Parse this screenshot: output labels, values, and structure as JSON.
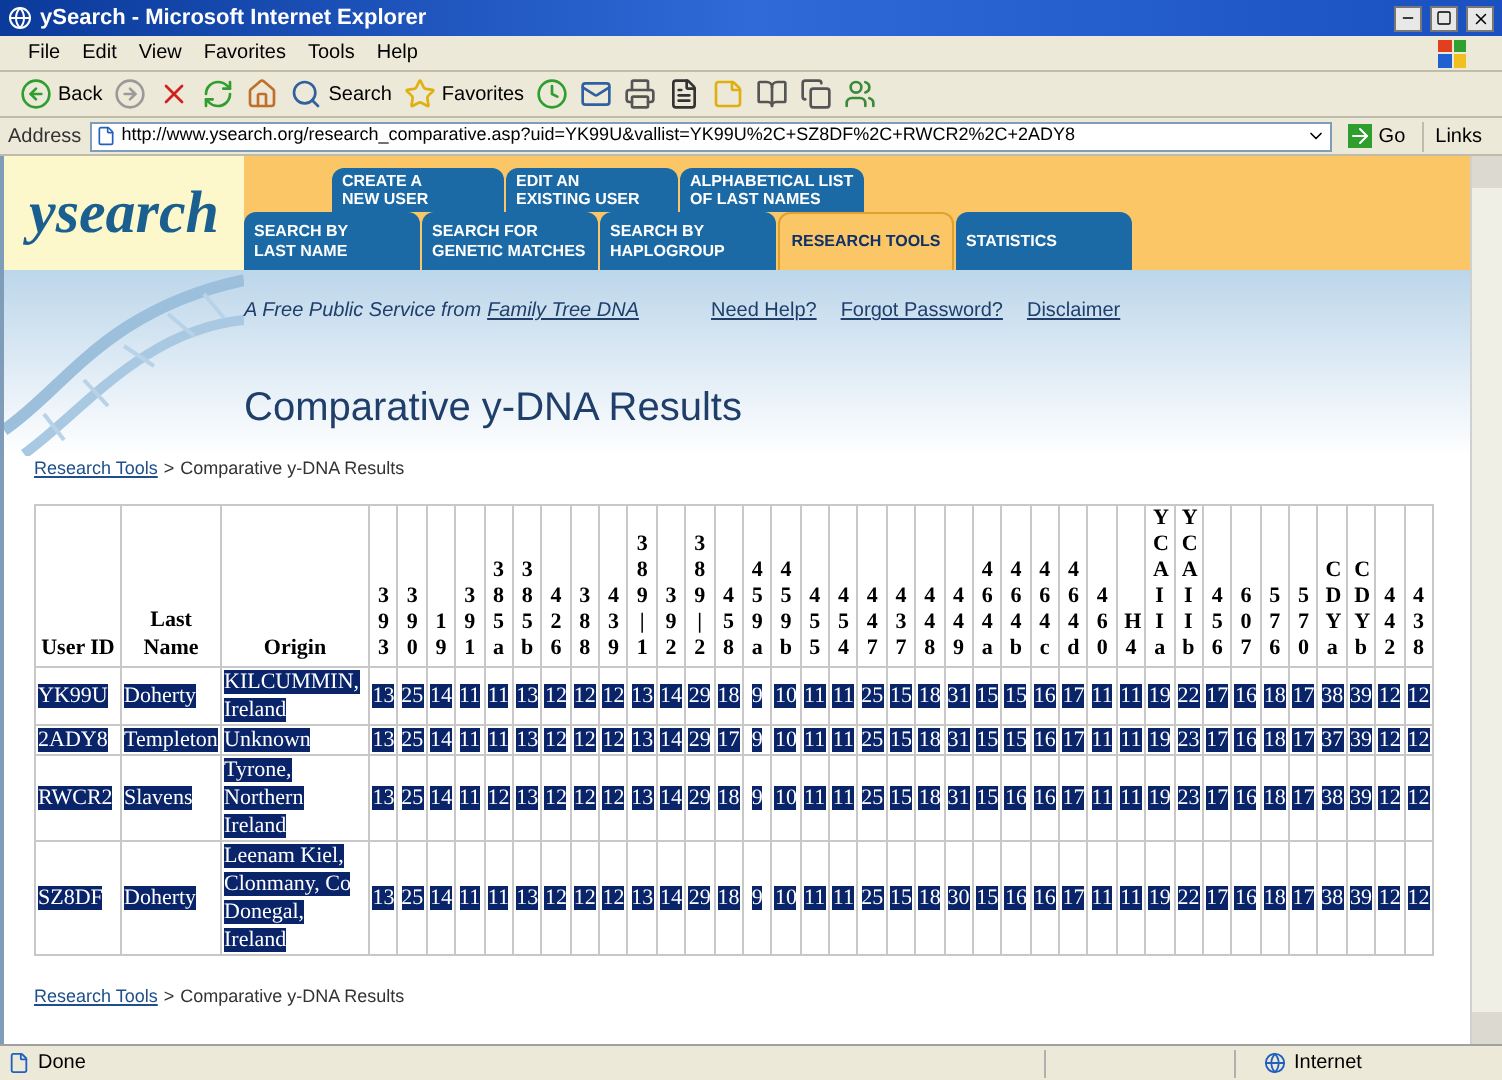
{
  "window": {
    "title": "ySearch - Microsoft Internet Explorer"
  },
  "menu": [
    "File",
    "Edit",
    "View",
    "Favorites",
    "Tools",
    "Help"
  ],
  "toolbar": [
    {
      "kind": "back",
      "label": "Back"
    },
    {
      "kind": "forward"
    },
    {
      "kind": "stop"
    },
    {
      "kind": "refresh"
    },
    {
      "kind": "home"
    },
    {
      "kind": "search",
      "label": "Search"
    },
    {
      "kind": "favorites",
      "label": "Favorites"
    },
    {
      "kind": "history"
    },
    {
      "kind": "mail"
    },
    {
      "kind": "print"
    },
    {
      "kind": "edit"
    },
    {
      "kind": "note"
    },
    {
      "kind": "research"
    },
    {
      "kind": "copy"
    },
    {
      "kind": "messenger"
    }
  ],
  "address": {
    "label": "Address",
    "value": "http://www.ysearch.org/research_comparative.asp?uid=YK99U&vallist=YK99U%2C+SZ8DF%2C+RWCR2%2C+2ADY8",
    "go": "Go",
    "links": "Links"
  },
  "site": {
    "logo": "ysearch",
    "tabs_top": [
      {
        "label": "CREATE A\nNEW USER"
      },
      {
        "label": "EDIT AN\nEXISTING USER"
      },
      {
        "label": "ALPHABETICAL LIST\nOF LAST NAMES"
      }
    ],
    "tabs_bottom": [
      {
        "label": "SEARCH BY\nLAST NAME",
        "selected": false
      },
      {
        "label": "SEARCH FOR\nGENETIC MATCHES",
        "selected": false
      },
      {
        "label": "SEARCH BY\nHAPLOGROUP",
        "selected": false
      },
      {
        "label": "RESEARCH TOOLS",
        "selected": true
      },
      {
        "label": "STATISTICS",
        "selected": false
      }
    ],
    "tagline": "A Free Public Service from",
    "tagline_link": "Family Tree DNA",
    "links": [
      "Need Help?",
      "Forgot Password?",
      "Disclaimer"
    ]
  },
  "page_title": "Comparative y-DNA Results",
  "breadcrumb_top": {
    "link": "Research Tools",
    "separator": ">",
    "current": "Comparative y-DNA Results"
  },
  "table": {
    "highlighted": true,
    "columns": [
      "User ID",
      "Last Name",
      "Origin",
      "393",
      "390",
      "19",
      "391",
      "385a",
      "385b",
      "426",
      "388",
      "439",
      "389|1",
      "392",
      "389|2",
      "458",
      "459a",
      "459b",
      "455",
      "454",
      "447",
      "437",
      "448",
      "449",
      "464a",
      "464b",
      "464c",
      "464d",
      "460",
      "H4",
      "YCAIIa",
      "YCAIIb",
      "456",
      "607",
      "576",
      "570",
      "CDYa",
      "CDYb",
      "442",
      "438"
    ],
    "rows": [
      {
        "user_id": "YK99U",
        "last_name": "Doherty",
        "origin": "KILCUMMIN, Ireland",
        "values": [
          "13",
          "25",
          "14",
          "11",
          "11",
          "13",
          "12",
          "12",
          "12",
          "13",
          "14",
          "29",
          "18",
          "9",
          "10",
          "11",
          "11",
          "25",
          "15",
          "18",
          "31",
          "15",
          "15",
          "16",
          "17",
          "11",
          "11",
          "19",
          "22",
          "17",
          "16",
          "18",
          "17",
          "38",
          "39",
          "12",
          "12"
        ]
      },
      {
        "user_id": "2ADY8",
        "last_name": "Templeton",
        "origin": "Unknown",
        "values": [
          "13",
          "25",
          "14",
          "11",
          "11",
          "13",
          "12",
          "12",
          "12",
          "13",
          "14",
          "29",
          "17",
          "9",
          "10",
          "11",
          "11",
          "25",
          "15",
          "18",
          "31",
          "15",
          "15",
          "16",
          "17",
          "11",
          "11",
          "19",
          "23",
          "17",
          "16",
          "18",
          "17",
          "37",
          "39",
          "12",
          "12"
        ]
      },
      {
        "user_id": "RWCR2",
        "last_name": "Slavens",
        "origin": "Tyrone, Northern Ireland",
        "values": [
          "13",
          "25",
          "14",
          "11",
          "12",
          "13",
          "12",
          "12",
          "12",
          "13",
          "14",
          "29",
          "18",
          "9",
          "10",
          "11",
          "11",
          "25",
          "15",
          "18",
          "31",
          "15",
          "16",
          "16",
          "17",
          "11",
          "11",
          "19",
          "23",
          "17",
          "16",
          "18",
          "17",
          "38",
          "39",
          "12",
          "12"
        ]
      },
      {
        "user_id": "SZ8DF",
        "last_name": "Doherty",
        "origin": "Leenam Kiel, Clonmany, Co Donegal, Ireland",
        "values": [
          "13",
          "25",
          "14",
          "11",
          "11",
          "13",
          "12",
          "12",
          "12",
          "13",
          "14",
          "29",
          "18",
          "9",
          "10",
          "11",
          "11",
          "25",
          "15",
          "18",
          "30",
          "15",
          "16",
          "16",
          "17",
          "11",
          "11",
          "19",
          "22",
          "17",
          "16",
          "18",
          "17",
          "38",
          "39",
          "12",
          "12"
        ]
      }
    ]
  },
  "breadcrumb_bottom": {
    "link": "Research Tools",
    "separator": ">",
    "current": "Comparative y-DNA Results"
  },
  "status_bar": {
    "text": "Done",
    "zone": "Internet"
  }
}
